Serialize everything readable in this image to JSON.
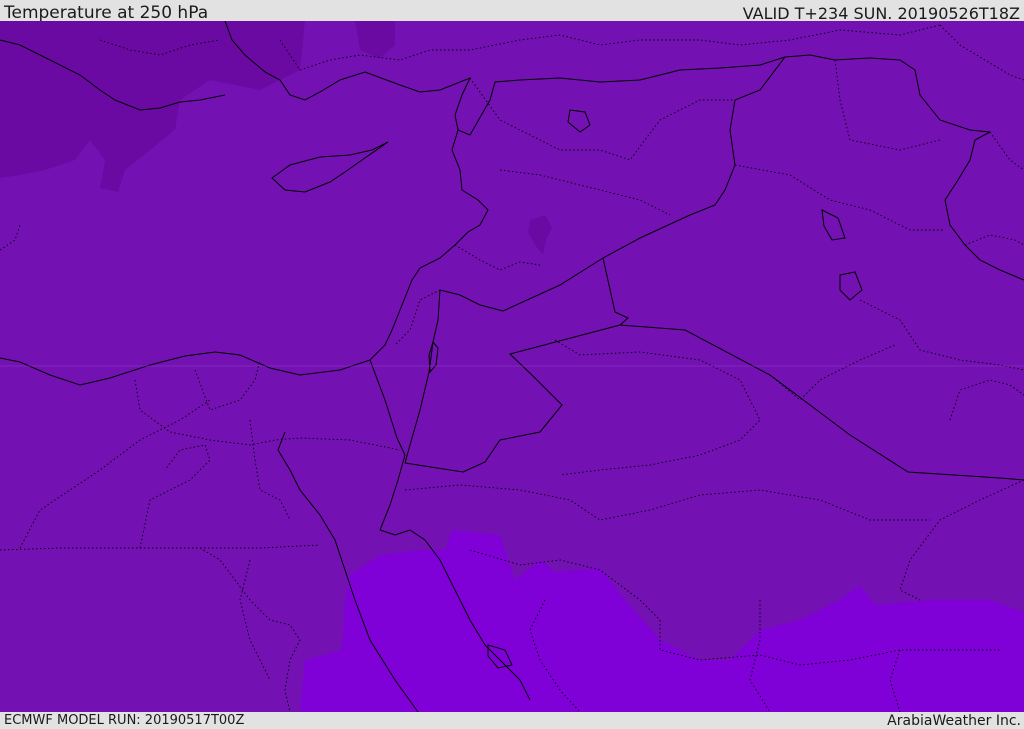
{
  "header": {
    "title": "Temperature at 250 hPa",
    "valid_time": "VALID T+234 SUN. 20190526T18Z"
  },
  "footer": {
    "model_run": "ECMWF MODEL RUN: 20190517T00Z",
    "credit": "ArabiaWeather Inc."
  },
  "map": {
    "variable": "temperature",
    "pressure_level_hPa": 250,
    "region": "Eastern Mediterranean and Middle East",
    "colors": {
      "base_field": "#7411b3",
      "cold_band": "#6a0aa3",
      "warm_band": "#8000d8",
      "coastline": "#000000",
      "borders": "#000000"
    }
  }
}
